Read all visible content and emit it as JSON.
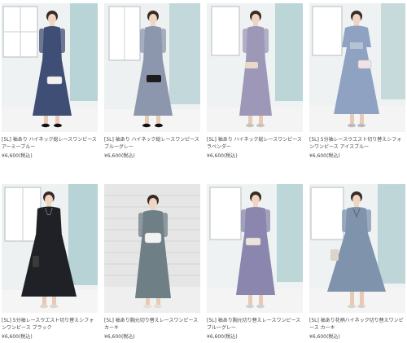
{
  "products": [
    {
      "name": "[5L] 袖あり ハイネック総レースワンピース アーミーブルー",
      "price": "¥6,600(税込)",
      "dress_color": "#3f4e74",
      "figure_icon": "dress-model-navy"
    },
    {
      "name": "[5L] 袖あり ハイネック総レースワンピース ブルーグレー",
      "price": "¥6,600(税込)",
      "dress_color": "#8c97ad",
      "figure_icon": "dress-model-bluegrey"
    },
    {
      "name": "[5L] 袖あり ハイネック総レースワンピース ラベンダー",
      "price": "¥6,600(税込)",
      "dress_color": "#9d97b8",
      "figure_icon": "dress-model-lavender"
    },
    {
      "name": "[5L] 5分袖レースウエスト切り替えシフォンワンピース アイスブルー",
      "price": "¥6,600(税込)",
      "dress_color": "#8fa2c2",
      "figure_icon": "dress-model-iceblue"
    },
    {
      "name": "[5L] 5分袖レースウエスト切り替えシフォンワンピース ブラック",
      "price": "¥6,600(税込)",
      "dress_color": "#1f2126",
      "figure_icon": "dress-model-black"
    },
    {
      "name": "[5L] 袖あり胸元切り替えレースワンピース カーキ",
      "price": "¥6,600(税込)",
      "dress_color": "#6f7f86",
      "figure_icon": "dress-model-khaki"
    },
    {
      "name": "[5L] 袖あり胸元切り替えレースワンピース ブルーグレー",
      "price": "¥6,600(税込)",
      "dress_color": "#8b86ad",
      "figure_icon": "dress-model-bluegrey"
    },
    {
      "name": "[5L] 袖あり花柄ハイネック切り替えワンピース カーキ",
      "price": "¥6,600(税込)",
      "dress_color": "#7f93ad",
      "figure_icon": "dress-model-khaki"
    }
  ]
}
